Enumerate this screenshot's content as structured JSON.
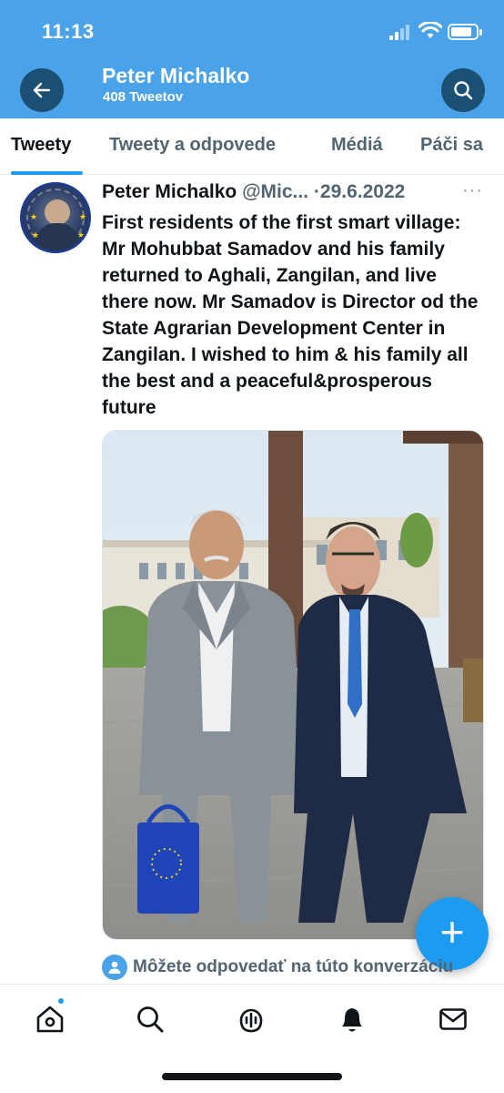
{
  "status_bar": {
    "time": "11:13"
  },
  "header": {
    "profile_name": "Peter Michalko",
    "tweet_count": "408 Tweetov"
  },
  "tabs": [
    {
      "label": "Tweety",
      "active": true
    },
    {
      "label": "Tweety a odpovede",
      "active": false
    },
    {
      "label": "Médiá",
      "active": false
    },
    {
      "label": "Páči sa",
      "active": false
    }
  ],
  "tweet": {
    "author_name": "Peter Michalko",
    "handle": "@Mic...",
    "separator": "·",
    "date": "29.6.2022",
    "more": "···",
    "text": "First residents of the first smart village: Mr Mohubbat Samadov and his family returned to Aghali, Zangilan, and live there now. Mr Samadov is Director od the State Agrarian Development Center in Zangilan. I wished to him & his family all the best and a peaceful&prosperous future"
  },
  "compose_button": {
    "label": "+"
  },
  "reply_notice": "Môžete odpovedať na túto konverzáciu",
  "bottom_nav": [
    {
      "name": "home-icon",
      "has_notification_dot": true
    },
    {
      "name": "search-icon"
    },
    {
      "name": "spaces-icon"
    },
    {
      "name": "notifications-icon",
      "active": true
    },
    {
      "name": "messages-icon"
    }
  ],
  "colors": {
    "header_blue": "#4aa3e9",
    "button_dark": "#1b4f73",
    "accent": "#1d9bf0",
    "text": "#0f1419",
    "muted": "#536471"
  }
}
